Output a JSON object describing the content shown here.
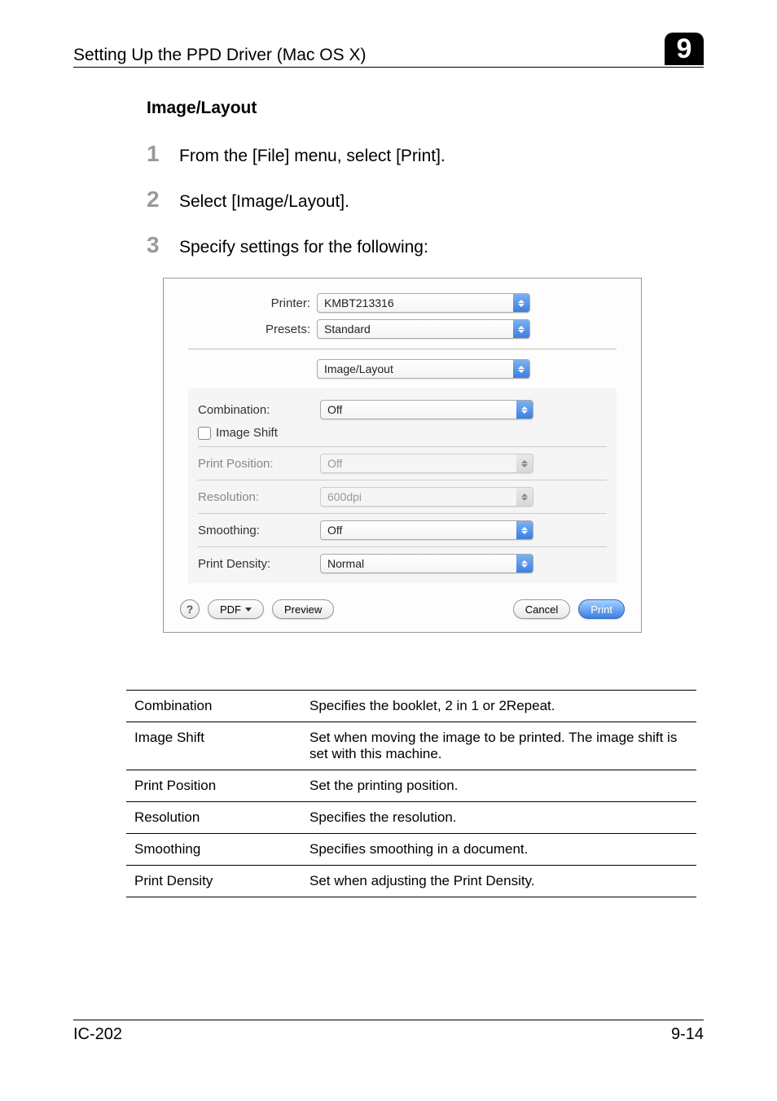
{
  "header": {
    "leftText": "Setting Up the PPD Driver (Mac OS X)",
    "chapterNumber": "9"
  },
  "section": {
    "title": "Image/Layout"
  },
  "steps": [
    {
      "num": "1",
      "text": "From the [File] menu, select [Print]."
    },
    {
      "num": "2",
      "text": "Select [Image/Layout]."
    },
    {
      "num": "3",
      "text": "Specify settings for the following:"
    }
  ],
  "dialog": {
    "printerLabel": "Printer:",
    "printerValue": "KMBT213316",
    "presetsLabel": "Presets:",
    "presetsValue": "Standard",
    "panelValue": "Image/Layout",
    "combinationLabel": "Combination:",
    "combinationValue": "Off",
    "imageShiftLabel": "Image Shift",
    "printPositionLabel": "Print Position:",
    "printPositionValue": "Off",
    "resolutionLabel": "Resolution:",
    "resolutionValue": "600dpi",
    "smoothingLabel": "Smoothing:",
    "smoothingValue": "Off",
    "printDensityLabel": "Print Density:",
    "printDensityValue": "Normal",
    "helpLabel": "?",
    "pdfLabel": "PDF",
    "previewLabel": "Preview",
    "cancelLabel": "Cancel",
    "printLabel": "Print"
  },
  "paramsTable": [
    {
      "name": "Combination",
      "desc": "Specifies the booklet, 2 in 1 or 2Repeat."
    },
    {
      "name": "Image Shift",
      "desc": "Set when moving the image to be printed. The image shift is set with this machine."
    },
    {
      "name": "Print Position",
      "desc": "Set the printing position."
    },
    {
      "name": "Resolution",
      "desc": "Specifies the resolution."
    },
    {
      "name": "Smoothing",
      "desc": "Specifies smoothing in a document."
    },
    {
      "name": "Print Density",
      "desc": "Set when adjusting the Print Density."
    }
  ],
  "footer": {
    "left": "IC-202",
    "right": "9-14"
  }
}
